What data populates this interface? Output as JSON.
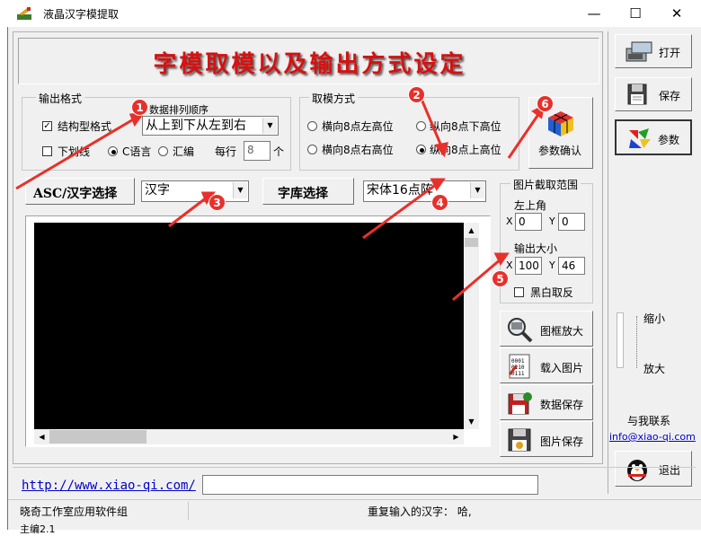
{
  "window": {
    "title": "液晶汉字模提取",
    "controls": {
      "minimize": "—",
      "maximize": "☐",
      "close": "✕"
    }
  },
  "banner": {
    "text": "字模取模以及输出方式设定"
  },
  "output_format": {
    "label": "输出格式",
    "struct_checkbox": {
      "label": "结构型格式",
      "checked": true
    },
    "order_label": "数据排列顺序",
    "order_select": "从上到下从左到右",
    "underline_checkbox": {
      "label": "下划线",
      "checked": false
    },
    "lang_c": "C语言",
    "lang_asm": "汇编",
    "lang_selected": "C",
    "per_row_label": "每行",
    "per_row_value": "8",
    "per_row_unit": "个"
  },
  "mode": {
    "label": "取模方式",
    "options": [
      "横向8点左高位",
      "纵向8点下高位",
      "横向8点右高位",
      "纵向8点上高位"
    ],
    "selected": "纵向8点上高位"
  },
  "param_confirm": {
    "label": "参数确认"
  },
  "asc_select": {
    "label": "ASC/汉字选择",
    "value": "汉字"
  },
  "font_select": {
    "label": "字库选择",
    "value": "宋体16点阵"
  },
  "crop": {
    "label": "图片截取范围",
    "top_left_label": "左上角",
    "x_label": "X",
    "y_label": "Y",
    "x_value": "0",
    "y_value": "0",
    "size_label": "输出大小",
    "w_value": "100",
    "h_value": "46",
    "invert_label": "黑白取反"
  },
  "tools": [
    {
      "label": "图框放大",
      "icon": "magnifier-icon"
    },
    {
      "label": "载入图片",
      "icon": "binary-document-icon"
    },
    {
      "label": "数据保存",
      "icon": "save-data-icon"
    },
    {
      "label": "图片保存",
      "icon": "save-image-icon"
    }
  ],
  "sidebar": {
    "open": "打开",
    "save": "保存",
    "params": "参数",
    "zoom_out": "缩小",
    "zoom_in": "放大",
    "contact_label": "与我联系",
    "email": "info@xiao-qi.com",
    "exit": "退出"
  },
  "footer": {
    "link": "http://www.xiao-qi.com/",
    "status_left": "晓奇工作室应用软件组",
    "status_right": "重复输入的汉字： 哈,",
    "version_partial": "主编2.1"
  },
  "markers": [
    "1",
    "2",
    "3",
    "4",
    "5",
    "6"
  ],
  "colors": {
    "banner_red": "#d81010",
    "marker_red": "#e8302b",
    "link_blue": "#0000cc",
    "canvas": "#000000"
  }
}
